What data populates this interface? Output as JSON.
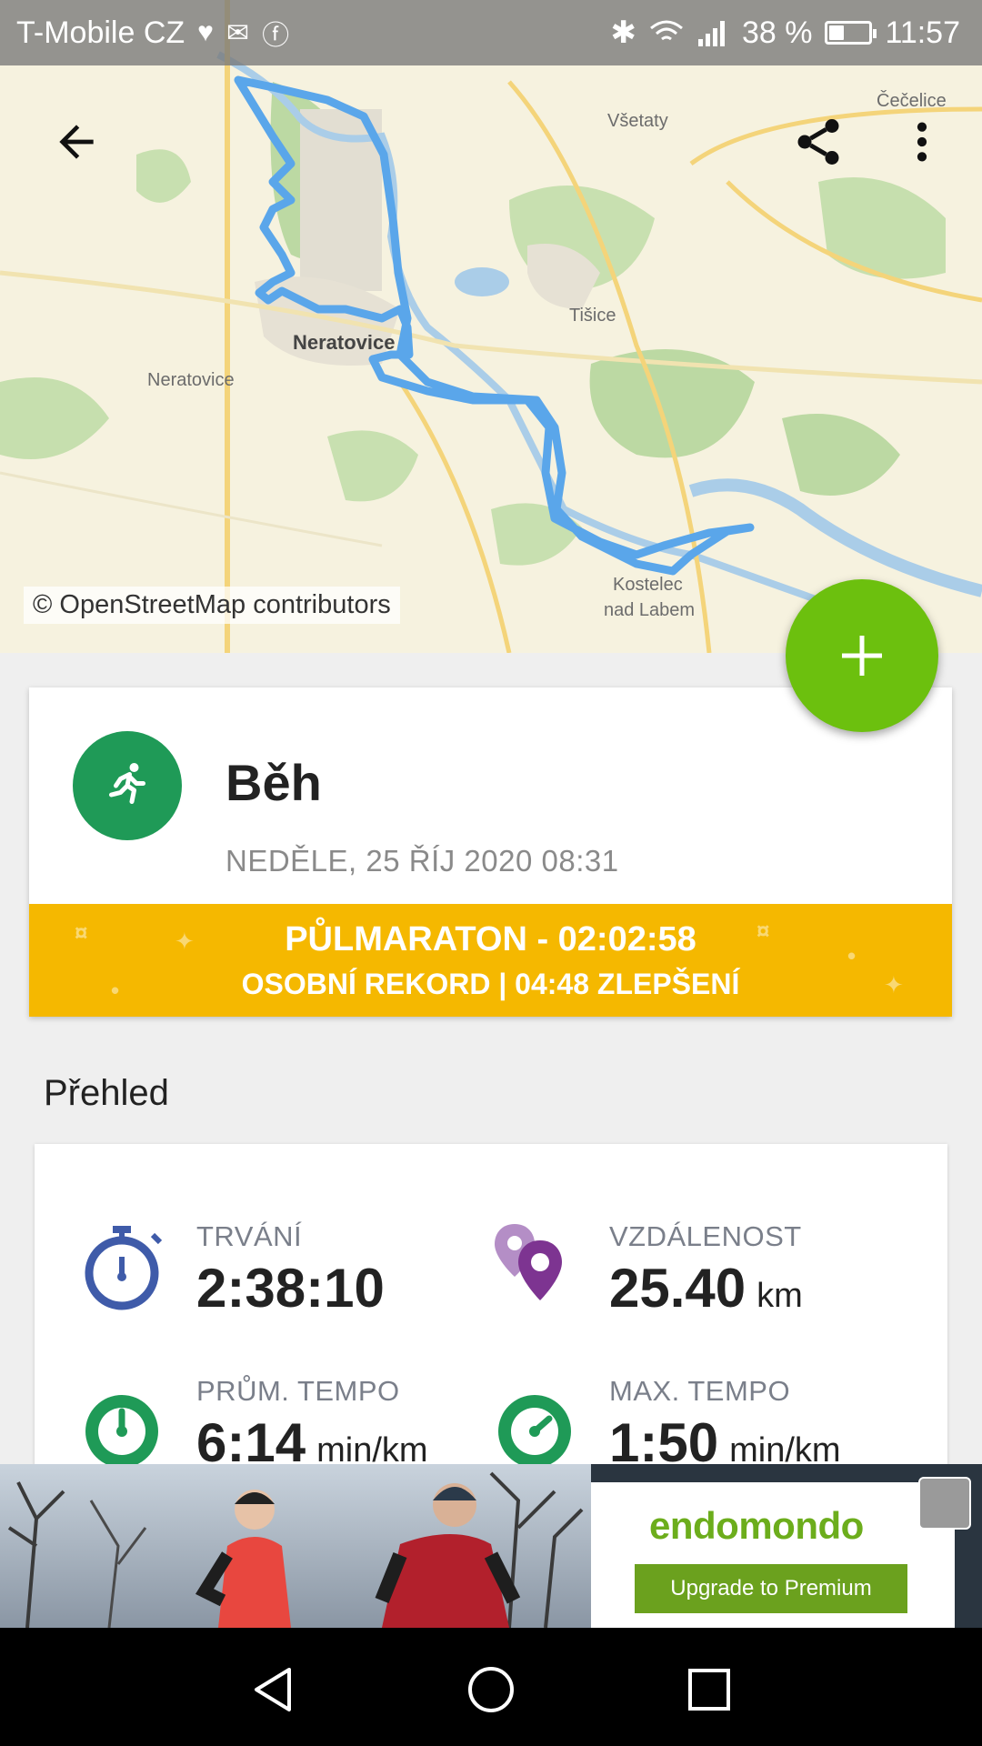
{
  "status_bar": {
    "carrier": "T-Mobile CZ",
    "battery_percent": "38 %",
    "battery_level": 0.38,
    "time": "11:57",
    "icons": [
      "heart-rate-icon",
      "mail-icon",
      "facebook-icon",
      "bluetooth-icon",
      "wifi-icon",
      "signal-icon",
      "battery-icon"
    ]
  },
  "map": {
    "attribution": "© OpenStreetMap contributors",
    "places": [
      "Všetaty",
      "Čečelice",
      "Tišice",
      "Neratovice",
      "Neratovice",
      "Kostelec",
      "nad Labem"
    ],
    "toolbar": {
      "back_icon": "arrow-back-icon",
      "share_icon": "share-icon",
      "more_icon": "more-vert-icon"
    }
  },
  "fab": {
    "icon": "plus-icon",
    "color": "#6cc00e"
  },
  "activity": {
    "sport": "Běh",
    "date": "NEDĚLE, 25 ŘÍJ 2020 08:31",
    "icon": "running-icon",
    "icon_color": "#1f9a57",
    "record": {
      "line1": "PŮLMARATON  -  02:02:58",
      "line2": "OSOBNÍ REKORD  |  04:48 ZLEPŠENÍ",
      "color": "#f5b800"
    }
  },
  "overview": {
    "title": "Přehled",
    "stats": [
      {
        "label": "TRVÁNÍ",
        "value": "2:38:10",
        "unit": "",
        "icon": "stopwatch-icon"
      },
      {
        "label": "VZDÁLENOST",
        "value": "25.40",
        "unit": "km",
        "icon": "location-pins-icon"
      },
      {
        "label": "PRŮM. TEMPO",
        "value": "6:14",
        "unit": "min/km",
        "icon": "speedometer-icon"
      },
      {
        "label": "MAX. TEMPO",
        "value": "1:50",
        "unit": "min/km",
        "icon": "speedometer-icon"
      }
    ]
  },
  "ad": {
    "brand": "endomondo",
    "cta": "Upgrade to Premium"
  },
  "nav": {
    "back": "nav-back-icon",
    "home": "nav-home-icon",
    "recents": "nav-recents-icon"
  }
}
